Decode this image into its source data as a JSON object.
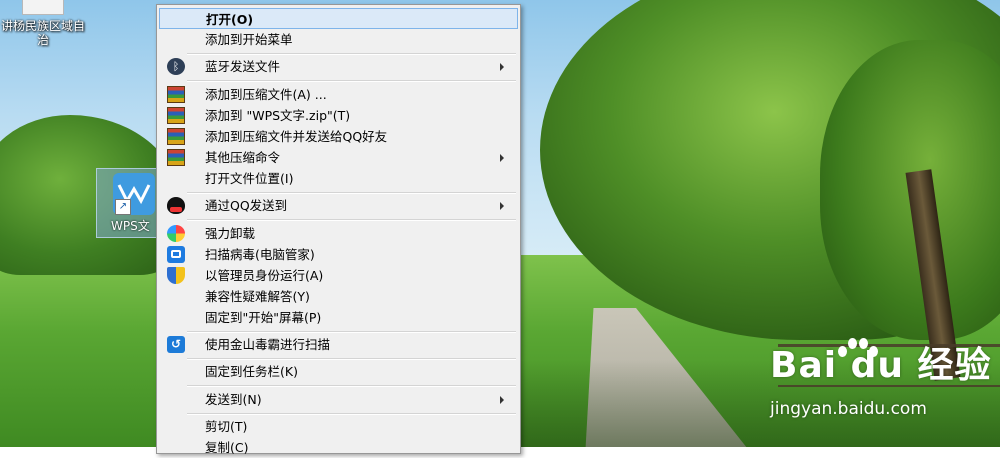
{
  "desktop": {
    "icons": [
      {
        "label": "讲杨民族区域自治"
      },
      {
        "label": "WPS文"
      }
    ],
    "watermark": {
      "logo_text": "Bai du 经验",
      "url": "jingyan.baidu.com"
    }
  },
  "context_menu": {
    "items": [
      {
        "label": "打开(O)",
        "icon": "none",
        "submenu": false,
        "highlighted": true,
        "bold": true
      },
      {
        "label": "添加到开始菜单",
        "icon": "none",
        "submenu": false
      },
      {
        "label": "蓝牙发送文件",
        "icon": "bluetooth-icon",
        "submenu": true
      },
      {
        "label": "添加到压缩文件(A) ...",
        "icon": "winrar-icon",
        "submenu": false
      },
      {
        "label": "添加到 \"WPS文字.zip\"(T)",
        "icon": "winrar-icon",
        "submenu": false
      },
      {
        "label": "添加到压缩文件并发送给QQ好友",
        "icon": "winrar-icon",
        "submenu": false
      },
      {
        "label": "其他压缩命令",
        "icon": "winrar-icon",
        "submenu": true
      },
      {
        "label": "打开文件位置(I)",
        "icon": "none",
        "submenu": false
      },
      {
        "label": "通过QQ发送到",
        "icon": "qq-icon",
        "submenu": true
      },
      {
        "label": "强力卸载",
        "icon": "uninstall-icon",
        "submenu": false
      },
      {
        "label": "扫描病毒(电脑管家)",
        "icon": "pc-manager-icon",
        "submenu": false
      },
      {
        "label": "以管理员身份运行(A)",
        "icon": "uac-shield-icon",
        "submenu": false
      },
      {
        "label": "兼容性疑难解答(Y)",
        "icon": "none",
        "submenu": false
      },
      {
        "label": "固定到\"开始\"屏幕(P)",
        "icon": "none",
        "submenu": false
      },
      {
        "label": "使用金山毒霸进行扫描",
        "icon": "kingsoft-antivirus-icon",
        "submenu": false
      },
      {
        "label": "固定到任务栏(K)",
        "icon": "none",
        "submenu": false
      },
      {
        "label": "发送到(N)",
        "icon": "none",
        "submenu": true
      },
      {
        "label": "剪切(T)",
        "icon": "none",
        "submenu": false
      },
      {
        "label": "复制(C)",
        "icon": "none",
        "submenu": false
      }
    ]
  }
}
